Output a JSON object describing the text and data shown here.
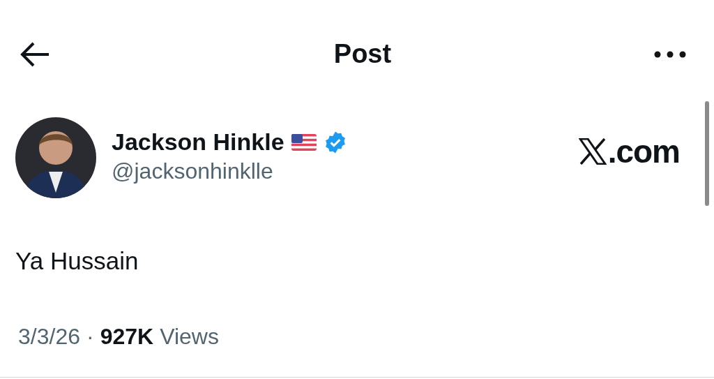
{
  "header": {
    "title": "Post"
  },
  "author": {
    "name": "Jackson Hinkle",
    "handle": "@jacksonhinklle",
    "verified": true
  },
  "watermark_site": {
    "domain": ".com"
  },
  "post": {
    "text": "Ya Hussain"
  },
  "meta": {
    "date": "3/3/26",
    "separator": "·",
    "views_count": "927K",
    "views_label": "Views"
  }
}
